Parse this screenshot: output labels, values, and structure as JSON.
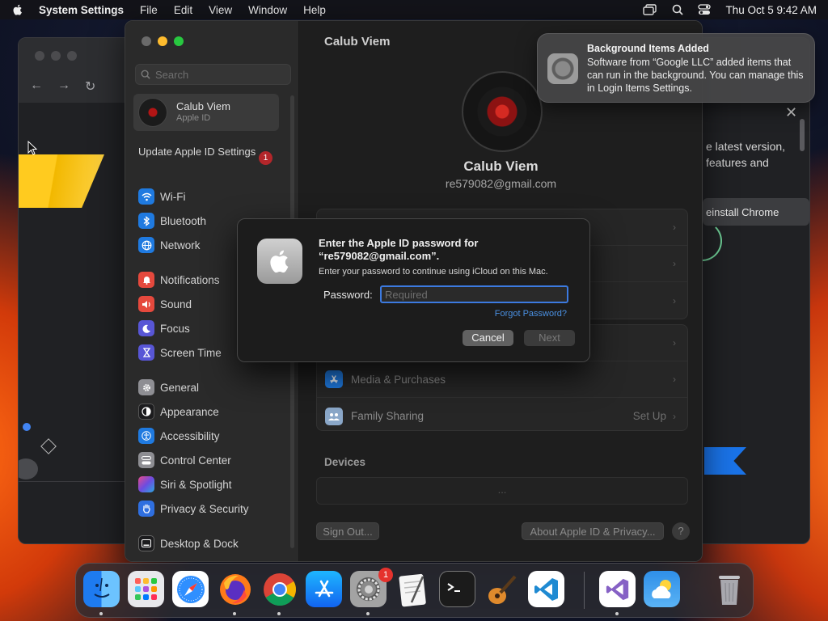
{
  "menubar": {
    "app_name": "System Settings",
    "menus": [
      "File",
      "Edit",
      "View",
      "Window",
      "Help"
    ],
    "clock": "Thu Oct 5  9:42 AM"
  },
  "chrome": {
    "promo_text_1": "e latest version,",
    "promo_text_2": "features and",
    "reinstall_label": "einstall Chrome"
  },
  "settings": {
    "search_placeholder": "Search",
    "account": {
      "name": "Calub Viem",
      "subtitle": "Apple ID"
    },
    "update_label": "Update Apple ID Settings",
    "update_badge": "1",
    "sidebar_items": [
      {
        "label": "Wi-Fi",
        "icon": "wifi-icon",
        "color": "#1f7ae0"
      },
      {
        "label": "Bluetooth",
        "icon": "bluetooth-icon",
        "color": "#1f7ae0"
      },
      {
        "label": "Network",
        "icon": "globe-icon",
        "color": "#1f7ae0"
      },
      {
        "label": "Notifications",
        "icon": "bell-icon",
        "color": "#e5493d"
      },
      {
        "label": "Sound",
        "icon": "speaker-icon",
        "color": "#e5493d"
      },
      {
        "label": "Focus",
        "icon": "moon-icon",
        "color": "#5856d6"
      },
      {
        "label": "Screen Time",
        "icon": "hourglass-icon",
        "color": "#5856d6"
      },
      {
        "label": "General",
        "icon": "gear-icon",
        "color": "#8e8e93"
      },
      {
        "label": "Appearance",
        "icon": "appearance-icon",
        "color": "#1c1c1e"
      },
      {
        "label": "Accessibility",
        "icon": "accessibility-icon",
        "color": "#1f7ae0"
      },
      {
        "label": "Control Center",
        "icon": "control-center-icon",
        "color": "#8e8e93"
      },
      {
        "label": "Siri & Spotlight",
        "icon": "siri-icon",
        "color": "#a05cd6"
      },
      {
        "label": "Privacy & Security",
        "icon": "hand-icon",
        "color": "#2f6fe0"
      },
      {
        "label": "Desktop & Dock",
        "icon": "dock-icon",
        "color": "#1c1c1e"
      }
    ],
    "content_title": "Calub Viem",
    "profile_name": "Calub Viem",
    "profile_email": "re579082@gmail.com",
    "rows_group2": [
      {
        "label": "Media & Purchases",
        "value": ""
      },
      {
        "label": "Family Sharing",
        "value": "Set Up"
      }
    ],
    "devices_label": "Devices",
    "devices_placeholder": "...",
    "sign_out_label": "Sign Out...",
    "about_label": "About Apple ID & Privacy...",
    "help_label": "?"
  },
  "dialog": {
    "title": "Enter the Apple ID password for “re579082@gmail.com”.",
    "subtitle": "Enter your password to continue using iCloud on this Mac.",
    "password_label": "Password:",
    "password_placeholder": "Required",
    "forgot_label": "Forgot Password?",
    "cancel_label": "Cancel",
    "next_label": "Next"
  },
  "notification": {
    "title": "Background Items Added",
    "body": "Software from “Google LLC” added items that can run in the background. You can manage this in Login Items Settings."
  },
  "dock": {
    "apps": [
      "Finder",
      "Launchpad",
      "Safari",
      "Firefox",
      "Google Chrome",
      "App Store",
      "System Settings",
      "TextEdit",
      "Terminal",
      "GarageBand",
      "Visual Studio Code",
      "Visual Studio",
      "Weather",
      "Trash"
    ],
    "settings_badge": "1"
  }
}
